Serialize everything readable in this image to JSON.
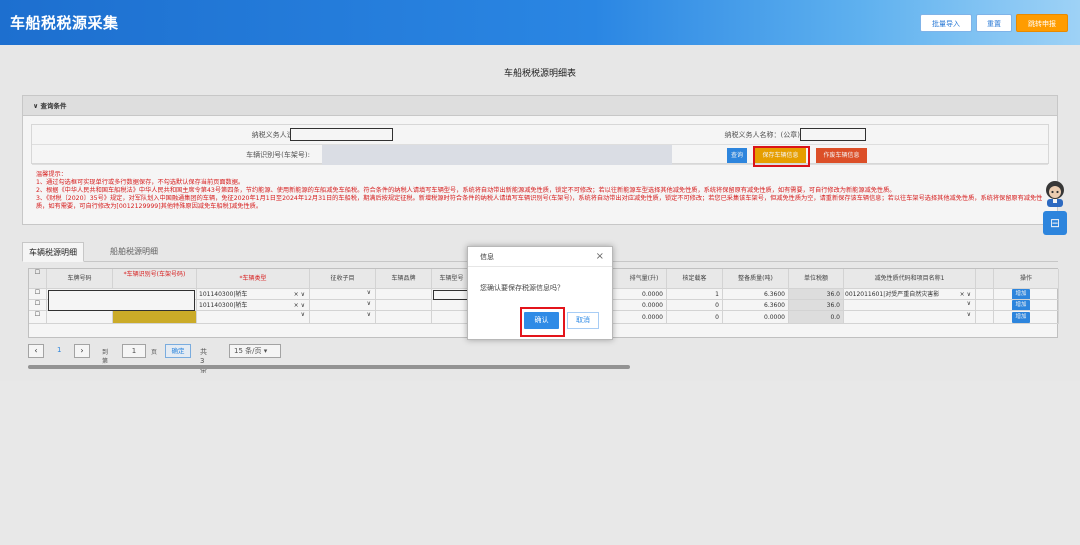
{
  "header": {
    "app_title": "车船税税源采集",
    "batch_import_label": "批量导入",
    "reset_label": "重置",
    "jump_declare_label": "跳转申报"
  },
  "form_title": "车船税税源明细表",
  "query": {
    "section_label": "查询条件",
    "taxpayer_id_label": "纳税义务人识别号:",
    "taxpayer_name_label": "纳税义务人名称：(公章)",
    "vehicle_id_label": "车辆识别号(车架号):",
    "query_button": "查询",
    "save_vehicle_button": "保存车辆信息",
    "void_vehicle_button": "作废车辆信息"
  },
  "tips": [
    "温馨提示：",
    "1、通过勾选框可实现单行或多行数据保存，不勾选默认保存当前页面数据。",
    "2、根据《中华人民共和国车船税法》中华人民共和国主席令第43号第四条，节约能源、使用新能源的车船减免车船税。符合条件的纳税人请填写车辆型号，系统将自动带出新能源减免性质，锁定不可修改；若以往新能源车型选择其他减免性质，系统将保留原有减免性质，如有需要，可自行修改为新能源减免性质。",
    "3、《财税〔2020〕35号》规定，对军队划入中国融通集团的车辆，免征2020年1月1日至2024年12月31日的车船税，期满后按规定征税。新增税源时符合条件的纳税人请填写车辆识别号(车架号)，系统将自动带出对应减免性质，锁定不可修改；若您已采集该车架号，但减免性质为空，请重新保存该车辆信息；若以往车架号选择其他减免性质，系统将保留原有减免性质，如有需要，可自行修改为[0012129999]其他特殊原因减免车船税]减免性质。"
  ],
  "tabs": [
    {
      "label": "车辆税源明细"
    },
    {
      "label": "船舶税源明细"
    }
  ],
  "grid": {
    "columns": [
      "车牌号码",
      "*车辆识别号(车架号码)",
      "*车辆类型",
      "征收子目",
      "车辆品牌",
      "车辆型号",
      "排气量(升)",
      "核定载客",
      "整备质量(吨)",
      "单位税额",
      "减免性质代码和项目名称1",
      "",
      "操作"
    ],
    "rows": [
      {
        "vehicle_type": "101140300|轿车",
        "displacement": "0.0000",
        "seats": "1",
        "curb_weight": "6.3600",
        "unit_tax": "36.0",
        "exemption": "0012011601|对受严重自然灾害影",
        "action": "增加"
      },
      {
        "vehicle_type": "101140300|轿车",
        "displacement": "0.0000",
        "seats": "0",
        "curb_weight": "6.3600",
        "unit_tax": "36.0",
        "exemption": "",
        "action": "增加"
      },
      {
        "vehicle_type": "",
        "displacement": "0.0000",
        "seats": "0",
        "curb_weight": "0.0000",
        "unit_tax": "0.0",
        "exemption": "",
        "action": "增加"
      }
    ]
  },
  "pager": {
    "current_page": "1",
    "page_input": "1",
    "goto_label": "到第",
    "page_label": "页",
    "confirm_label": "确定",
    "total_label": "共3条",
    "page_size": "15 条/页"
  },
  "dialog": {
    "title": "信息",
    "message": "您确认要保存税源信息吗？",
    "ok_label": "确认",
    "cancel_label": "取消"
  },
  "side": {
    "button_glyph": "⊟"
  },
  "colors": {
    "header_blue": "#1d6fcf",
    "accent_orange": "#ff9c00",
    "highlight_red": "#e3141b",
    "primary_blue": "#2f8be6"
  }
}
